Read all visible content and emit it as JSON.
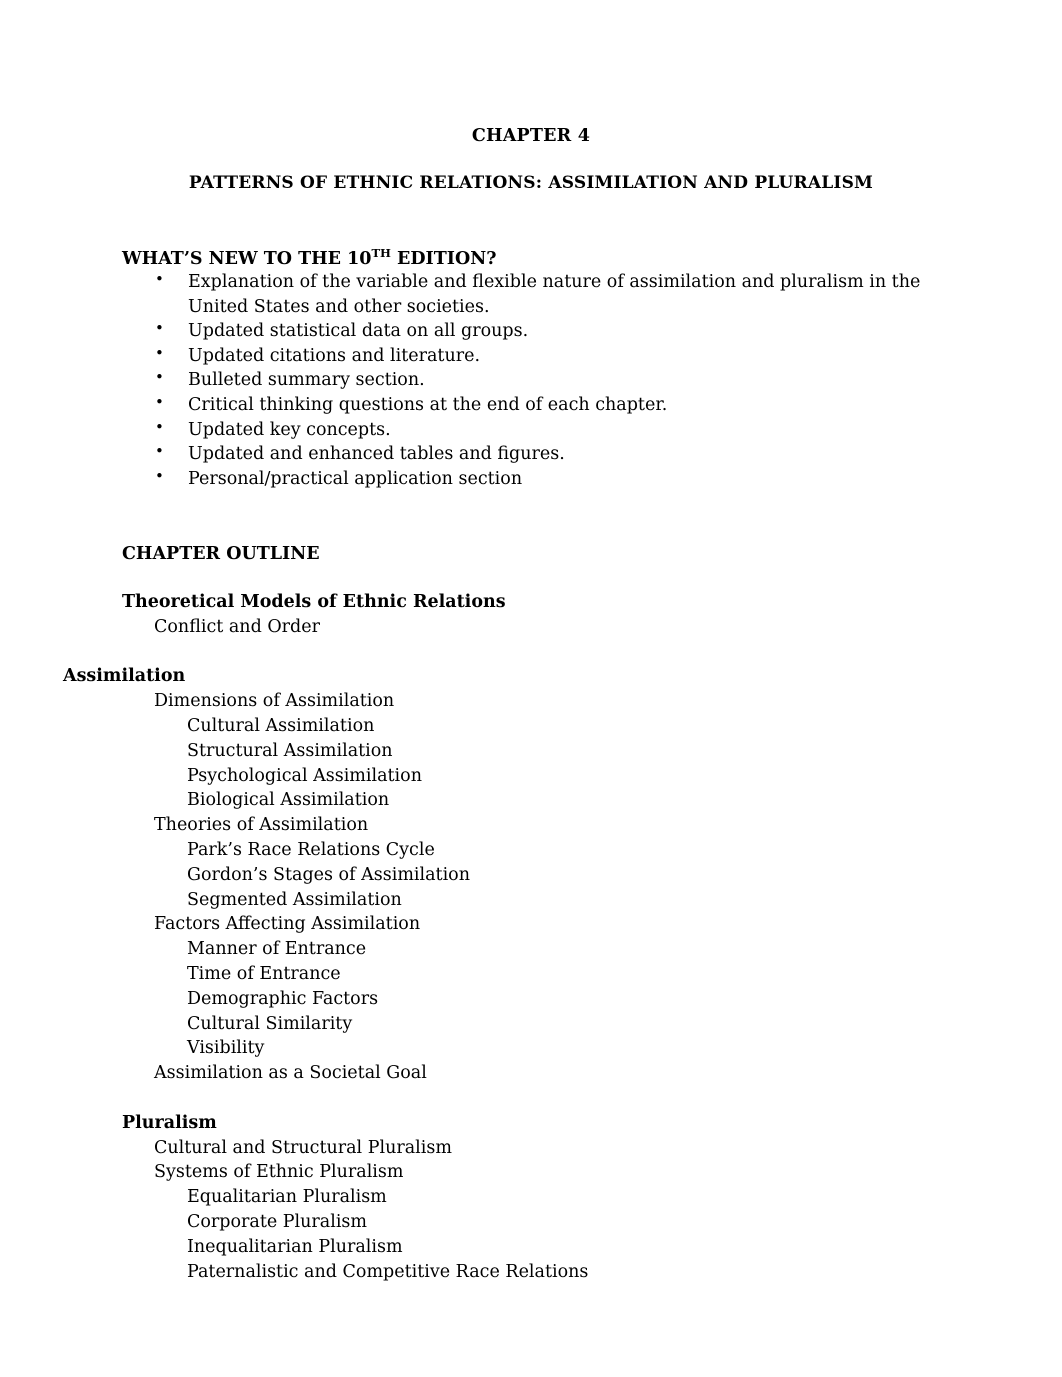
{
  "document": {
    "chapter_title": "CHAPTER 4",
    "subject_title": "PATTERNS OF ETHNIC RELATIONS: ASSIMILATION AND PLURALISM"
  },
  "whats_new": {
    "heading_prefix": "WHAT’S NEW TO THE 10",
    "heading_superscript": "TH",
    "heading_suffix": " EDITION?",
    "bullet_glyph": "•",
    "items": [
      "Explanation of the variable and flexible nature of assimilation and pluralism in the United States and other societies.",
      "Updated statistical data on all groups.",
      "Updated citations and literature.",
      "Bulleted summary section.",
      "Critical thinking questions at the end of each chapter.",
      "Updated key concepts.",
      "Updated and enhanced tables and figures.",
      "Personal/practical application section"
    ]
  },
  "chapter_outline": {
    "heading": "CHAPTER OUTLINE",
    "lines": [
      {
        "text": "Theoretical Models of Ethnic Relations",
        "level": "head1"
      },
      {
        "text": "Conflict and Order",
        "level": "1"
      },
      {
        "text": "",
        "level": "spacer"
      },
      {
        "text": "Assimilation",
        "level": "head0"
      },
      {
        "text": "Dimensions of Assimilation",
        "level": "1"
      },
      {
        "text": "Cultural Assimilation",
        "level": "2"
      },
      {
        "text": "Structural Assimilation",
        "level": "2"
      },
      {
        "text": "Psychological Assimilation",
        "level": "2"
      },
      {
        "text": "Biological Assimilation",
        "level": "2"
      },
      {
        "text": "Theories of Assimilation",
        "level": "1"
      },
      {
        "text": "Park’s Race Relations Cycle",
        "level": "2"
      },
      {
        "text": "Gordon’s Stages of Assimilation",
        "level": "2"
      },
      {
        "text": "Segmented Assimilation",
        "level": "2"
      },
      {
        "text": "Factors Affecting Assimilation",
        "level": "1"
      },
      {
        "text": "Manner of Entrance",
        "level": "2"
      },
      {
        "text": "Time of Entrance",
        "level": "2"
      },
      {
        "text": "Demographic Factors",
        "level": "2"
      },
      {
        "text": "Cultural Similarity",
        "level": "2"
      },
      {
        "text": "Visibility",
        "level": "2"
      },
      {
        "text": "Assimilation as a Societal Goal",
        "level": "1"
      },
      {
        "text": "",
        "level": "spacer"
      },
      {
        "text": "Pluralism",
        "level": "head1"
      },
      {
        "text": "Cultural and Structural Pluralism",
        "level": "1"
      },
      {
        "text": "Systems of Ethnic Pluralism",
        "level": "1"
      },
      {
        "text": "Equalitarian Pluralism",
        "level": "2"
      },
      {
        "text": "Corporate Pluralism",
        "level": "2"
      },
      {
        "text": "Inequalitarian Pluralism",
        "level": "2"
      },
      {
        "text": "Paternalistic and Competitive Race Relations",
        "level": "2"
      }
    ]
  }
}
